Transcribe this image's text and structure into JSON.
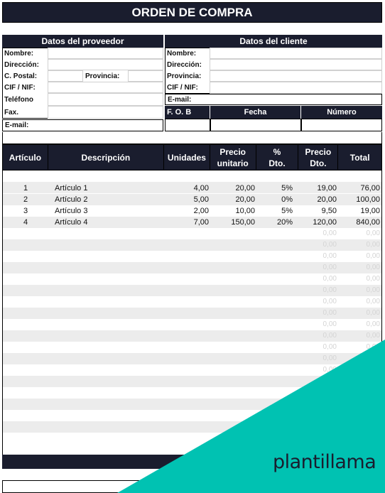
{
  "title": "ORDEN DE COMPRA",
  "supplier": {
    "header": "Datos del proveedor",
    "labels": {
      "name": "Nombre:",
      "address": "Dirección:",
      "postal": "C. Postal:",
      "province": "Provincia:",
      "cif": "CIF / NIF:",
      "phone": "Teléfono",
      "fax": "Fax.",
      "email": "E-mail:"
    }
  },
  "client": {
    "header": "Datos del cliente",
    "labels": {
      "name": "Nombre:",
      "address": "Dirección:",
      "province": "Provincia:",
      "cif": "CIF / NIF:",
      "email": "E-mail:"
    },
    "fob": "F. O. B",
    "date": "Fecha",
    "number": "Número"
  },
  "table": {
    "columns": [
      "Artículo",
      "Descripción",
      "Unidades",
      "Precio unitario",
      "% Dto.",
      "Precio Dto.",
      "Total"
    ],
    "rows": [
      {
        "item": "1",
        "description": "Artículo 1",
        "units": "4,00",
        "unit_price": "20,00",
        "discount": "5%",
        "discounted_price": "19,00",
        "total": "76,00"
      },
      {
        "item": "2",
        "description": "Artículo 2",
        "units": "5,00",
        "unit_price": "20,00",
        "discount": "0%",
        "discounted_price": "20,00",
        "total": "100,00"
      },
      {
        "item": "3",
        "description": "Artículo 3",
        "units": "2,00",
        "unit_price": "10,00",
        "discount": "5%",
        "discounted_price": "9,50",
        "total": "19,00"
      },
      {
        "item": "4",
        "description": "Artículo 4",
        "units": "7,00",
        "unit_price": "150,00",
        "discount": "20%",
        "discounted_price": "120,00",
        "total": "840,00"
      }
    ],
    "empty_value": "0,00"
  },
  "brand": "plantillama",
  "colors": {
    "header": "#1a1d2e",
    "accent": "#00c2b2",
    "stripe": "#ececec"
  }
}
